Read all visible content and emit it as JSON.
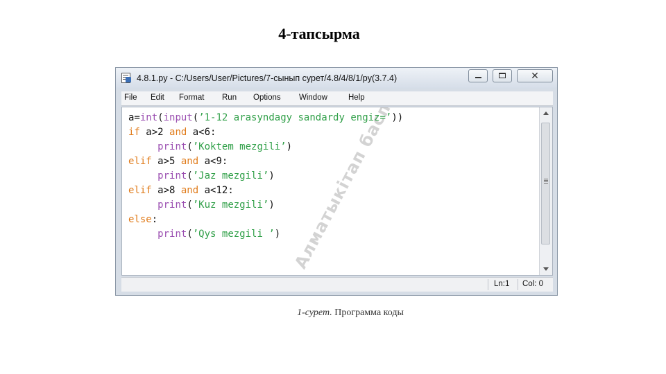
{
  "slide": {
    "title": "4-тапсырма",
    "caption_label": "1-сурет.",
    "caption_text": "Программа коды"
  },
  "window": {
    "title": "4.8.1.py - C:/Users/User/Pictures/7-сынып сурет/4.8/4/8/1/py(3.7.4)",
    "close_glyph": "✕"
  },
  "menu": [
    "File",
    "Edit",
    "Format",
    "Run",
    "Options",
    "Window",
    "Help"
  ],
  "code": [
    [
      {
        "t": "a="
      },
      {
        "t": "int",
        "c": "bi"
      },
      {
        "t": "("
      },
      {
        "t": "input",
        "c": "bi"
      },
      {
        "t": "("
      },
      {
        "t": "’1-12 arasyndagy sandardy engiz=’",
        "c": "str"
      },
      {
        "t": "))"
      }
    ],
    [
      {
        "t": "if",
        "c": "kw"
      },
      {
        "t": " a>2 "
      },
      {
        "t": "and",
        "c": "kw"
      },
      {
        "t": " a<6:"
      }
    ],
    [
      {
        "t": "     "
      },
      {
        "t": "print",
        "c": "bi"
      },
      {
        "t": "("
      },
      {
        "t": "’Koktem mezgili’",
        "c": "str"
      },
      {
        "t": ")"
      }
    ],
    [
      {
        "t": "elif",
        "c": "kw"
      },
      {
        "t": " a>5 "
      },
      {
        "t": "and",
        "c": "kw"
      },
      {
        "t": " a<9:"
      }
    ],
    [
      {
        "t": "     "
      },
      {
        "t": "print",
        "c": "bi"
      },
      {
        "t": "("
      },
      {
        "t": "’Jaz mezgili’",
        "c": "str"
      },
      {
        "t": ")"
      }
    ],
    [
      {
        "t": "elif",
        "c": "kw"
      },
      {
        "t": " a>8 "
      },
      {
        "t": "and",
        "c": "kw"
      },
      {
        "t": " a<12:"
      }
    ],
    [
      {
        "t": "     "
      },
      {
        "t": "print",
        "c": "bi"
      },
      {
        "t": "("
      },
      {
        "t": "’Kuz mezgili’",
        "c": "str"
      },
      {
        "t": ")"
      }
    ],
    [
      {
        "t": "else",
        "c": "kw"
      },
      {
        "t": ":"
      }
    ],
    [
      {
        "t": "     "
      },
      {
        "t": "print",
        "c": "bi"
      },
      {
        "t": "("
      },
      {
        "t": "’Qys mezgili ’",
        "c": "str"
      },
      {
        "t": ")"
      }
    ]
  ],
  "watermark": "Алматыкітап баспасы",
  "status": {
    "line": "Ln:1",
    "col": "Col: 0"
  },
  "colors": {
    "keyword": "#e07b1a",
    "builtin": "#9b4fb1",
    "string": "#31a049"
  }
}
